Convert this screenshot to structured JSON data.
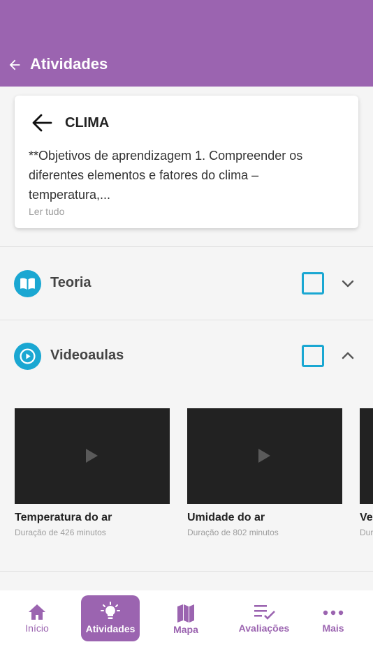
{
  "header": {
    "title": "Atividades"
  },
  "topic": {
    "title": "CLIMA",
    "description": "**Objetivos de aprendizagem  1. Compreender os diferentes elementos e fatores do clima – temperatura,...",
    "read_more": "Ler tudo"
  },
  "sections": [
    {
      "label": "Teoria",
      "icon": "book-icon",
      "expanded": false,
      "checked": false
    },
    {
      "label": "Videoaulas",
      "icon": "play-circle-icon",
      "expanded": true,
      "checked": false
    }
  ],
  "videos": [
    {
      "title": "Temperatura do ar",
      "duration": "Duração de 426 minutos"
    },
    {
      "title": "Umidade do ar",
      "duration": "Duração de 802 minutos"
    },
    {
      "title": "Ve",
      "duration": "Dur"
    }
  ],
  "nav": [
    {
      "label": "Início",
      "icon": "home-icon",
      "active": false
    },
    {
      "label": "Atividades",
      "icon": "lightbulb-icon",
      "active": true
    },
    {
      "label": "Mapa",
      "icon": "map-icon",
      "active": false
    },
    {
      "label": "Avaliações",
      "icon": "checklist-icon",
      "active": false
    },
    {
      "label": "Mais",
      "icon": "more-icon",
      "active": false
    }
  ],
  "colors": {
    "primary": "#9b64b0",
    "accent": "#1aa7d2"
  }
}
